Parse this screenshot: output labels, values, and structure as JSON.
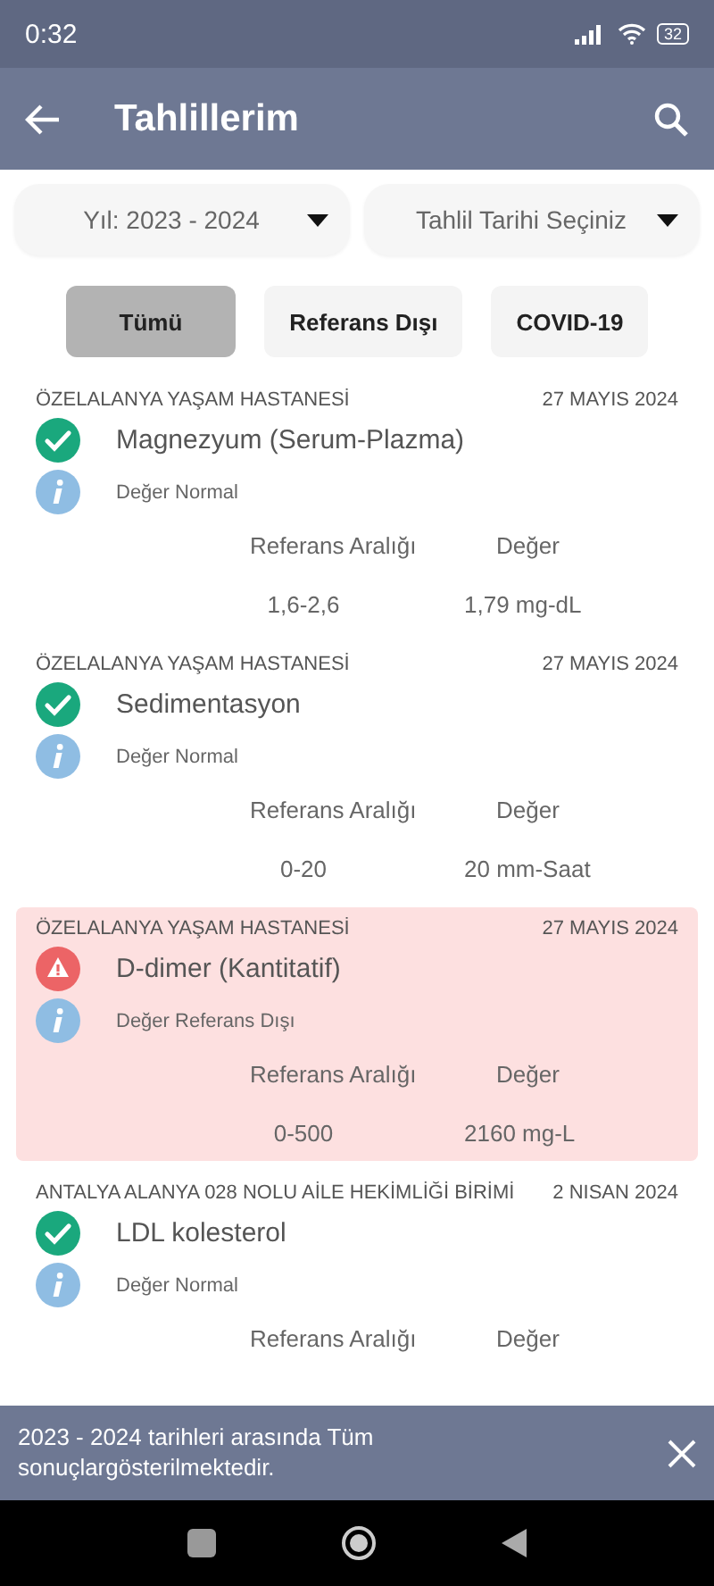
{
  "status_bar": {
    "time": "0:32",
    "battery": "32"
  },
  "app_bar": {
    "title": "Tahlillerim"
  },
  "filters": [
    {
      "label": "Yıl: 2023 - 2024"
    },
    {
      "label": "Tahlil Tarihi Seçiniz"
    }
  ],
  "chips": [
    {
      "label": "Tümü",
      "selected": true
    },
    {
      "label": "Referans Dışı",
      "selected": false
    },
    {
      "label": "COVID-19",
      "selected": false
    }
  ],
  "results": [
    {
      "institution": "ÖZELALANYA YAŞAM HASTANESİ",
      "date": "27 MAYIS 2024",
      "kind": "normal",
      "test": "Magnezyum (Serum-Plazma)",
      "status": "Değer Normal",
      "range_label": "Referans Aralığı",
      "value_label": "Değer",
      "range": "1,6-2,6",
      "value": "1,79 mg-dL"
    },
    {
      "institution": "ÖZELALANYA YAŞAM HASTANESİ",
      "date": "27 MAYIS 2024",
      "kind": "normal",
      "test": "Sedimentasyon",
      "status": "Değer Normal",
      "range_label": "Referans Aralığı",
      "value_label": "Değer",
      "range": "0-20",
      "value": "20 mm-Saat"
    },
    {
      "institution": "ÖZELALANYA YAŞAM HASTANESİ",
      "date": "27 MAYIS 2024",
      "kind": "out_of_range",
      "test": "D-dimer (Kantitatif)",
      "status": "Değer Referans Dışı",
      "range_label": "Referans Aralığı",
      "value_label": "Değer",
      "range": "0-500",
      "value": "2160 mg-L"
    },
    {
      "institution": "ANTALYA ALANYA 028 NOLU AİLE HEKİMLİĞİ BİRİMİ",
      "date": "2 NISAN 2024",
      "kind": "normal",
      "test": "LDL kolesterol",
      "status": "Değer Normal",
      "range_label": "Referans Aralığı",
      "value_label": "Değer"
    }
  ],
  "banner": {
    "message": "2023 - 2024 tarihleri arasında Tüm sonuçlargösterilmektedir."
  }
}
